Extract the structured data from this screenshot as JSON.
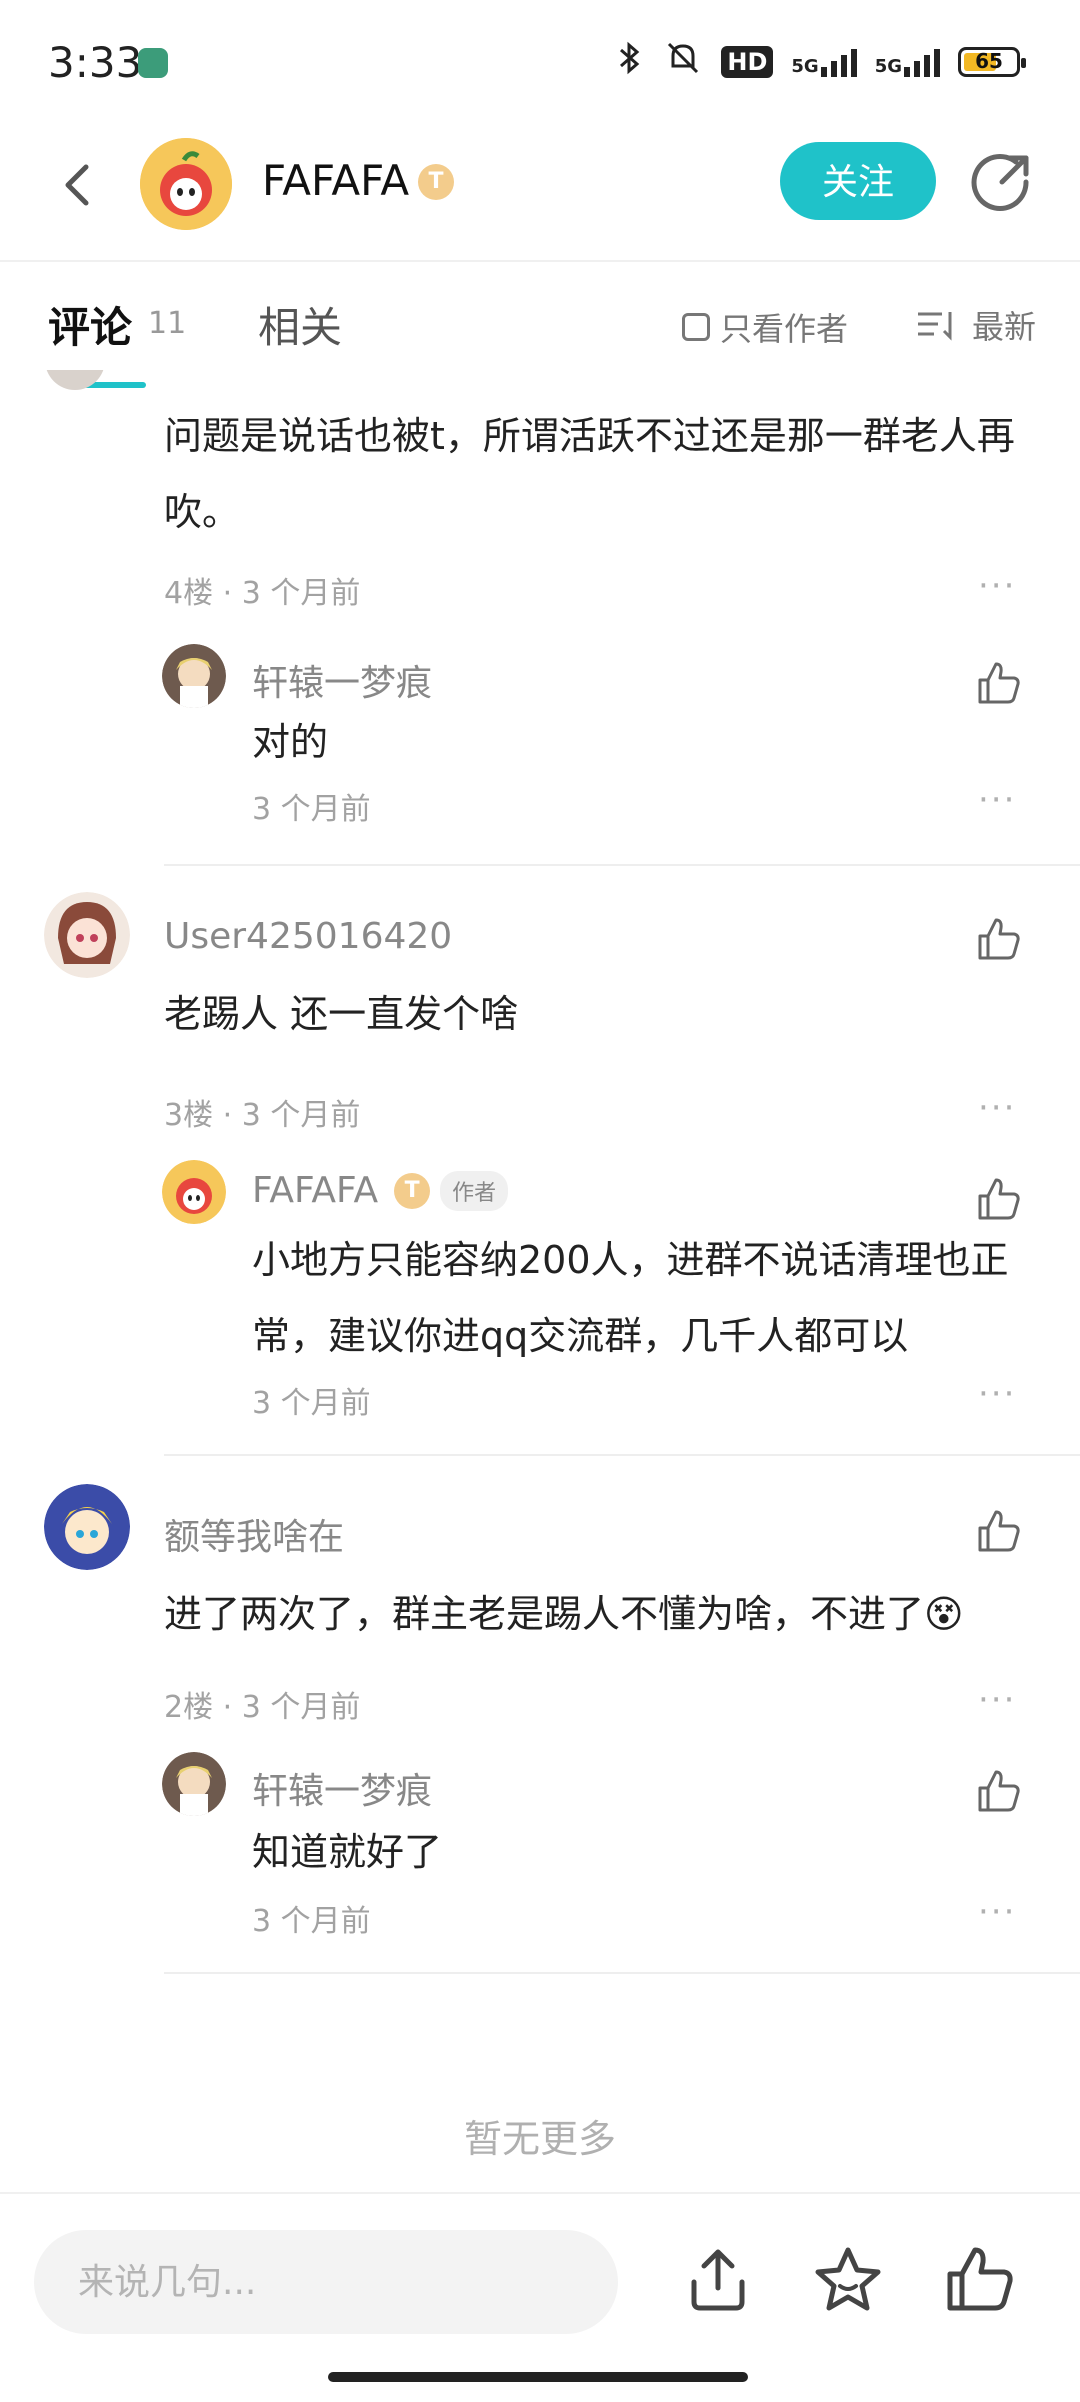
{
  "status_bar": {
    "time": "3:33",
    "network": "5G",
    "network2": "5G",
    "hd": "HD",
    "battery": "65"
  },
  "header": {
    "username": "FAFAFA",
    "level_badge": "T",
    "follow_label": "关注"
  },
  "tabs": {
    "comments_label": "评论",
    "comments_count": "11",
    "related_label": "相关",
    "only_author_label": "只看作者",
    "sort_label": "最新"
  },
  "comments": [
    {
      "text_line1": "问题是说话也被t，所谓活跃不过还是那一群老人再",
      "text_line2": "吹。",
      "floor": "4楼 · 3 个月前",
      "reply": {
        "name": "轩辕一梦痕",
        "text": "对的",
        "time": "3 个月前"
      }
    },
    {
      "name": "User425016420",
      "text_line1": "老踢人 还一直发个啥",
      "floor": "3楼 · 3 个月前",
      "reply": {
        "name": "FAFAFA",
        "badge": "T",
        "author_tag": "作者",
        "text_line1": "小地方只能容纳200人，进群不说话清理也正",
        "text_line2": "常，建议你进qq交流群，几千人都可以",
        "time": "3 个月前"
      }
    },
    {
      "name": "额等我啥在",
      "text_line1": "进了两次了，群主老是踢人不懂为啥，不进了",
      "emoji": "😵",
      "floor": "2楼 · 3 个月前",
      "reply": {
        "name": "轩辕一梦痕",
        "text": "知道就好了",
        "time": "3 个月前"
      }
    }
  ],
  "more_glyph": "···",
  "end_text": "暂无更多",
  "bottom_bar": {
    "input_placeholder": "来说几句..."
  }
}
